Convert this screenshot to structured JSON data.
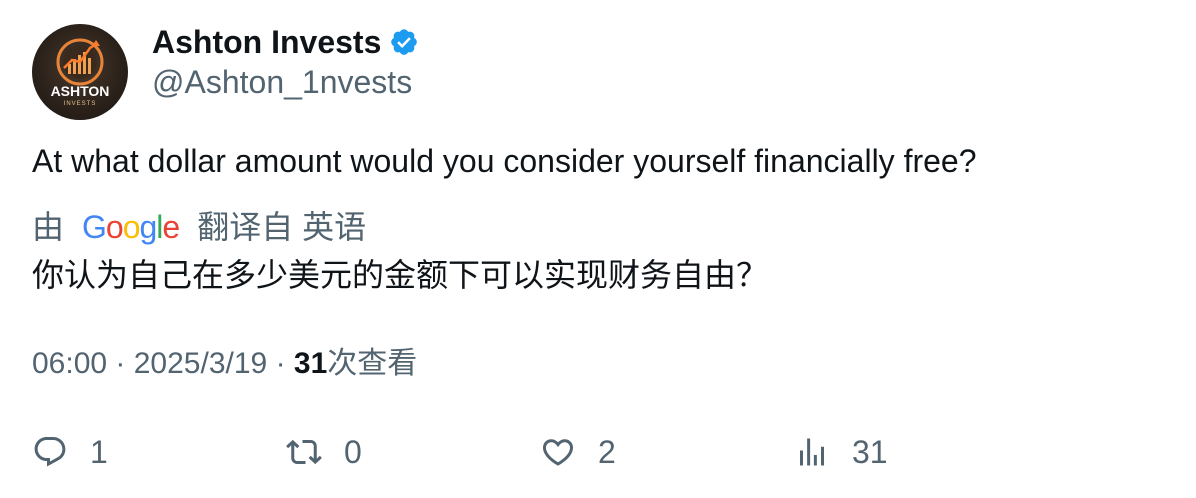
{
  "author": {
    "display_name": "Ashton Invests",
    "handle": "@Ashton_1nvests",
    "verified": true,
    "avatar_text": "ASHTON",
    "avatar_subtext": "INVESTS"
  },
  "tweet": {
    "text": "At what dollar amount would you consider yourself financially free?",
    "translation_prefix": "由",
    "translation_provider": "Google",
    "translation_suffix": "翻译自 英语",
    "translated_text": "你认为自己在多少美元的金额下可以实现财务自由？"
  },
  "meta": {
    "time": "06:00",
    "separator": "·",
    "date": "2025/3/19",
    "views_count": "31",
    "views_label": "次查看"
  },
  "actions": {
    "replies": "1",
    "retweets": "0",
    "likes": "2",
    "views": "31"
  },
  "colors": {
    "verified_badge": "#1d9bf0",
    "secondary_text": "#536471",
    "primary_text": "#0f1419"
  }
}
